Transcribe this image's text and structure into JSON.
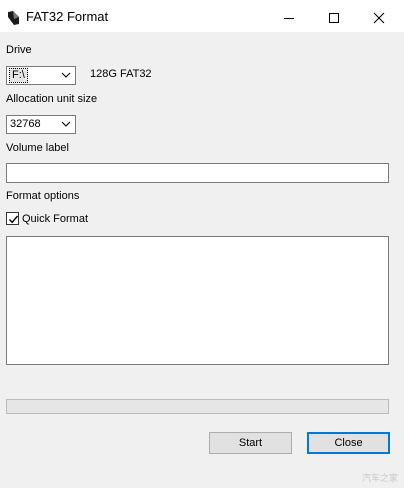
{
  "window": {
    "title": "FAT32 Format"
  },
  "drive": {
    "label": "Drive",
    "selected": "F:\\",
    "info": "128G FAT32"
  },
  "allocation": {
    "label": "Allocation unit size",
    "selected": "32768"
  },
  "volume": {
    "label": "Volume label",
    "value": ""
  },
  "options": {
    "label": "Format options",
    "quick_format_label": "Quick Format",
    "quick_format_checked": true
  },
  "progress": {
    "fraction": 0
  },
  "buttons": {
    "start": "Start",
    "close": "Close"
  },
  "watermark": "汽车之家",
  "colors": {
    "progress_fill": "#06b025",
    "default_button_border": "#0078d7"
  }
}
